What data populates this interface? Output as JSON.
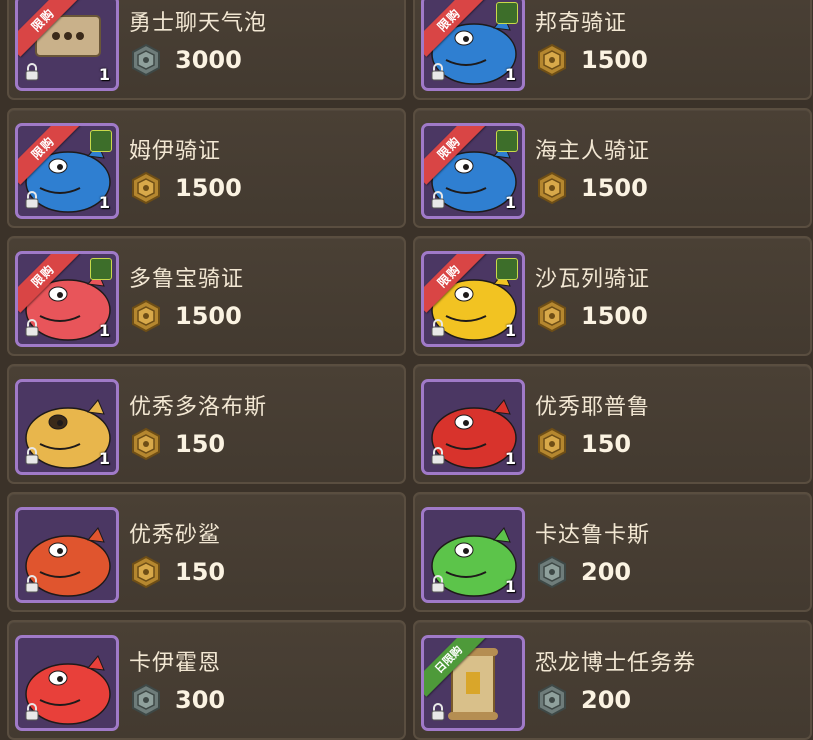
{
  "colors": {
    "background": "#3b3229",
    "card": "#4a4035",
    "thumb_border": "#a07ac8",
    "ribbon_red": "#d94545",
    "ribbon_green": "#4e9a3a",
    "gold_coin": "#b5872f",
    "silver_coin": "#6e7c7a"
  },
  "items": [
    {
      "title": "勇士聊天气泡",
      "price": "3000",
      "currency": "silver",
      "qty": "1",
      "ribbon": "限购",
      "ribbon_color": "red",
      "badge": false,
      "art": "chat-bubble-icon"
    },
    {
      "title": "邦奇骑证",
      "price": "1500",
      "currency": "gold",
      "qty": "1",
      "ribbon": "限购",
      "ribbon_color": "red",
      "badge": true,
      "art": "blue-dragon"
    },
    {
      "title": "姆伊骑证",
      "price": "1500",
      "currency": "gold",
      "qty": "1",
      "ribbon": "限购",
      "ribbon_color": "red",
      "badge": true,
      "art": "blue-dragon"
    },
    {
      "title": "海主人骑证",
      "price": "1500",
      "currency": "gold",
      "qty": "1",
      "ribbon": "限购",
      "ribbon_color": "red",
      "badge": true,
      "art": "blue-dragon"
    },
    {
      "title": "多鲁宝骑证",
      "price": "1500",
      "currency": "gold",
      "qty": "1",
      "ribbon": "限购",
      "ribbon_color": "red",
      "badge": true,
      "art": "red-dragon"
    },
    {
      "title": "沙瓦列骑证",
      "price": "1500",
      "currency": "gold",
      "qty": "1",
      "ribbon": "限购",
      "ribbon_color": "red",
      "badge": true,
      "art": "yellow-dragon"
    },
    {
      "title": "优秀多洛布斯",
      "price": "150",
      "currency": "gold",
      "qty": "1",
      "ribbon": "",
      "ribbon_color": "",
      "badge": false,
      "art": "yellow-dino"
    },
    {
      "title": "优秀耶普鲁",
      "price": "150",
      "currency": "gold",
      "qty": "1",
      "ribbon": "",
      "ribbon_color": "",
      "badge": false,
      "art": "red-serpent"
    },
    {
      "title": "优秀砂鲨",
      "price": "150",
      "currency": "gold",
      "qty": "",
      "ribbon": "",
      "ribbon_color": "",
      "badge": false,
      "art": "sand-shark"
    },
    {
      "title": "卡达鲁卡斯",
      "price": "200",
      "currency": "silver",
      "qty": "1",
      "ribbon": "",
      "ribbon_color": "",
      "badge": false,
      "art": "green-turtle"
    },
    {
      "title": "卡伊霍恩",
      "price": "300",
      "currency": "silver",
      "qty": "",
      "ribbon": "",
      "ribbon_color": "",
      "badge": false,
      "art": "red-fire-dino"
    },
    {
      "title": "恐龙博士任务券",
      "price": "200",
      "currency": "silver",
      "qty": "",
      "ribbon": "日限购",
      "ribbon_color": "green",
      "badge": false,
      "art": "scroll-ticket"
    }
  ]
}
